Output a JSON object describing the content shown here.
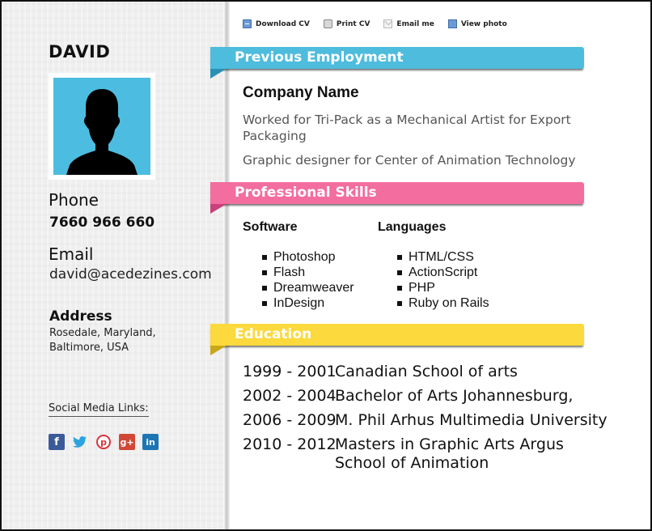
{
  "toolbar": {
    "items": [
      {
        "label": "Download CV",
        "icon": "download-icon"
      },
      {
        "label": "Print CV",
        "icon": "printer-icon"
      },
      {
        "label": "Email me",
        "icon": "envelope-icon"
      },
      {
        "label": "View photo",
        "icon": "photo-icon"
      }
    ]
  },
  "profile": {
    "name": "DAVID",
    "phone_label": "Phone",
    "phone": "7660 966 660",
    "email_label": "Email",
    "email": "david@acedezines.com",
    "address_label": "Address",
    "address_line1": "Rosedale,  Maryland,",
    "address_line2": "Baltimore, USA",
    "social_label": "Social Media Links:",
    "social": [
      {
        "name": "facebook",
        "glyph": "f"
      },
      {
        "name": "twitter",
        "glyph": "🐦"
      },
      {
        "name": "pinterest",
        "glyph": "P"
      },
      {
        "name": "google-plus",
        "glyph": "g+"
      },
      {
        "name": "linkedin",
        "glyph": "in"
      }
    ]
  },
  "colors": {
    "employment": "#4ebcdd",
    "skills": "#f36d9e",
    "education": "#fcd93d",
    "photo_bg": "#4cbde0"
  },
  "sections": {
    "employment": {
      "title": "Previous Employment",
      "company": "Company Name",
      "lines": [
        "Worked for Tri-Pack as a Mechanical Artist for Export Packaging",
        "Graphic designer for Center of Animation Technology"
      ]
    },
    "skills": {
      "title": "Professional Skills",
      "software": {
        "heading": "Software",
        "items": [
          "Photoshop",
          "Flash",
          "Dreamweaver",
          "InDesign"
        ]
      },
      "languages": {
        "heading": "Languages",
        "items": [
          "HTML/CSS",
          "ActionScript",
          "PHP",
          "Ruby on Rails"
        ]
      }
    },
    "education": {
      "title": "Education",
      "entries": [
        {
          "years": "1999 - 2001",
          "desc": "Canadian School of arts"
        },
        {
          "years": "2002 - 2004",
          "desc": "Bachelor of Arts Johannesburg,"
        },
        {
          "years": "2006 - 2009",
          "desc": "M. Phil Arhus Multimedia University"
        },
        {
          "years": "2010 - 2012",
          "desc": "Masters in Graphic Arts Argus School of Animation"
        }
      ]
    }
  }
}
